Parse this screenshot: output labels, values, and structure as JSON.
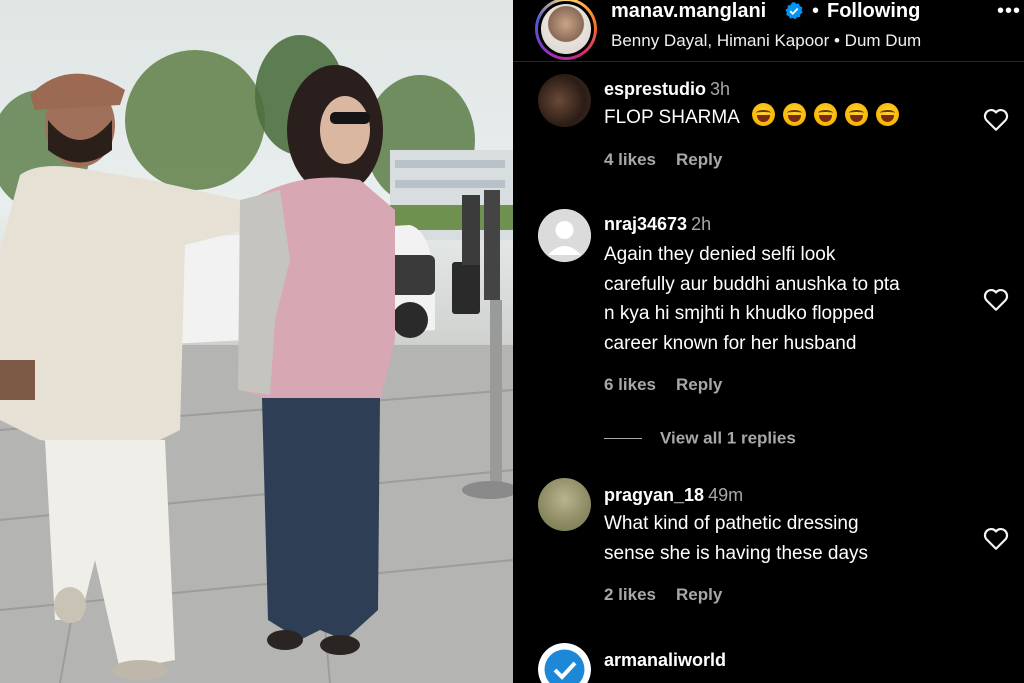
{
  "post": {
    "username": "manav.manglani",
    "verified": true,
    "separator": "•",
    "follow_status": "Following",
    "audio_location": "Benny Dayal, Himani Kapoor • Dum Dum",
    "more_icon": "more-options-icon"
  },
  "comments": [
    {
      "username": "esprestudio",
      "time": "3h",
      "text": "FLOP SHARMA",
      "emoji_count": 5,
      "emoji": "laughing-tears-emoji",
      "likes": "4 likes",
      "reply_label": "Reply"
    },
    {
      "username": "nraj34673",
      "time": "2h",
      "text_lines": [
        "Again they denied selfi look",
        "carefully aur buddhi anushka to pta",
        "n kya hi smjhti h khudko flopped",
        "career known for her husband"
      ],
      "likes": "6 likes",
      "reply_label": "Reply",
      "view_replies": "View all 1 replies"
    },
    {
      "username": "pragyan_18",
      "time": "49m",
      "text_lines": [
        "What kind of pathetic dressing",
        "sense she is having these days"
      ],
      "likes": "2 likes",
      "reply_label": "Reply"
    },
    {
      "username": "armanaliworld"
    }
  ],
  "colors": {
    "background": "#000000",
    "text": "#ffffff",
    "muted": "#a8a8a8",
    "verified_blue": "#0095f6"
  }
}
